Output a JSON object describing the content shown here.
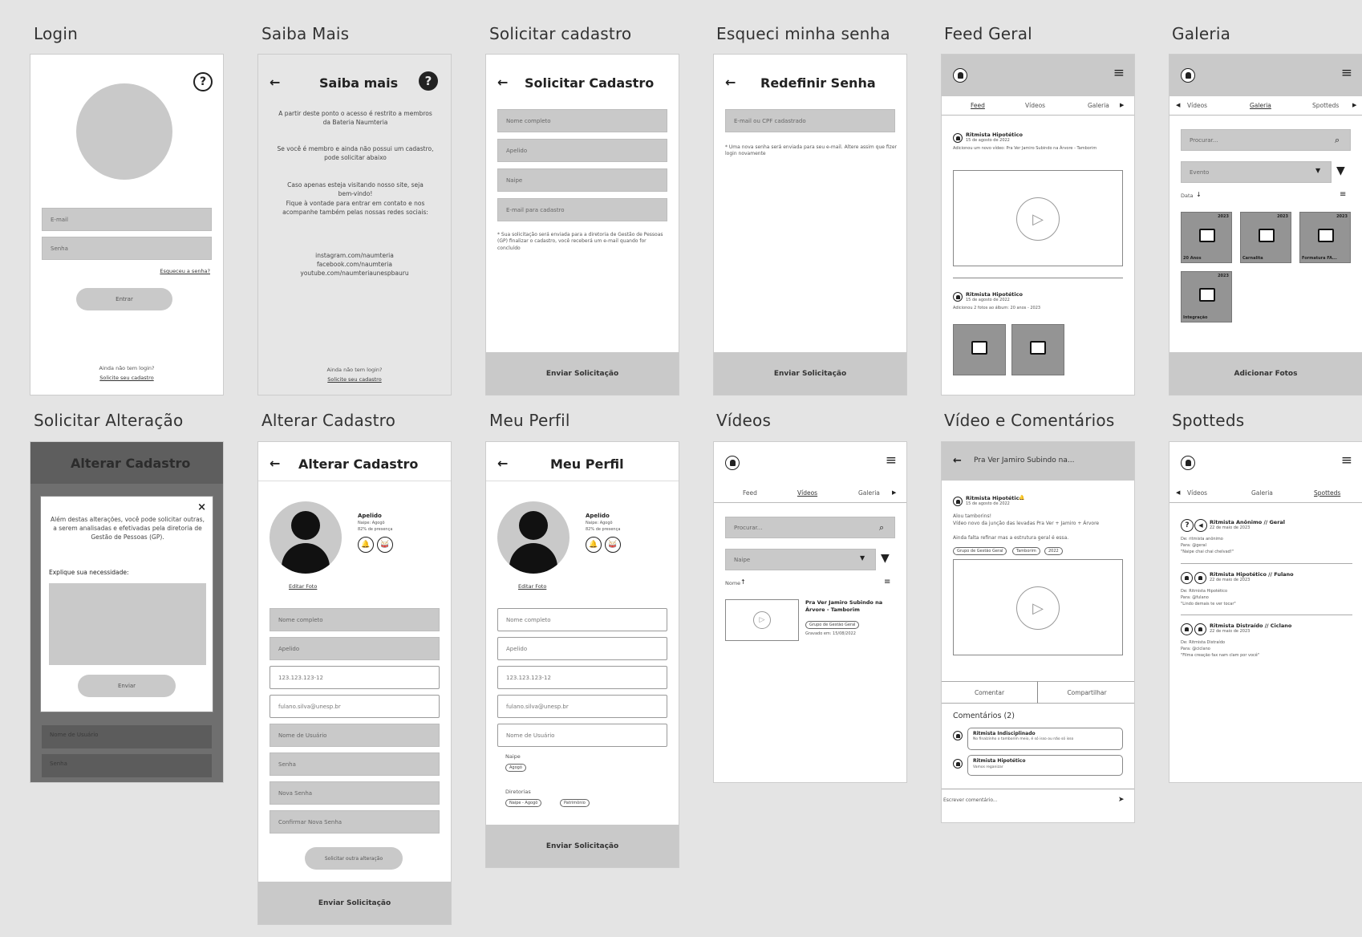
{
  "labels": [
    "Login",
    "Saiba Mais",
    "Solicitar cadastro",
    "Esqueci minha senha",
    "Feed Geral",
    "Galeria",
    "Solicitar Alteração",
    "Alterar Cadastro",
    "Meu Perfil",
    "Vídeos",
    "Vídeo e Comentários",
    "Spotteds"
  ],
  "login": {
    "help": "?",
    "email": "E-mail",
    "senha": "Senha",
    "forgot": "Esqueceu a senha?",
    "enter": "Entrar",
    "no_login": "Ainda não tem login?",
    "request": "Solicite seu cadastro"
  },
  "saiba": {
    "back": "←",
    "title": "Saiba mais",
    "help": "?",
    "p1": "A partir deste ponto o acesso é restrito a membros da Bateria Naumteria",
    "p2": "Se você é membro e ainda não possui um cadastro, pode solicitar abaixo",
    "p3": "Caso apenas esteja visitando nosso site, seja bem-vindo!",
    "p4": "Fique à vontade para entrar em contato e nos acompanhe também pelas nossas redes sociais:",
    "s1": "instagram.com/naumteria",
    "s2": "facebook.com/naumteria",
    "s3": "youtube.com/naumteriaunespbauru",
    "no_login": "Ainda não tem login?",
    "request": "Solicite seu cadastro"
  },
  "solicitar": {
    "back": "←",
    "title": "Solicitar Cadastro",
    "f1": "Nome completo",
    "f2": "Apelido",
    "f3": "Naipe",
    "f4": "E-mail para cadastro",
    "note": "* Sua solicitação será enviada para a diretoria de Gestão de Pessoas (GP) finalizar o cadastro, você receberá um e-mail quando for concluído",
    "submit": "Enviar Solicitação"
  },
  "esqueci": {
    "back": "←",
    "title": "Redefinir Senha",
    "f1": "E-mail ou CPF cadastrado",
    "note": "* Uma nova senha será enviada para seu e-mail. Altere assim que fizer login novamente",
    "submit": "Enviar Solicitação"
  },
  "feed": {
    "menu": "≡",
    "tab1": "Feed",
    "tab2": "Vídeos",
    "tab3": "Galeria",
    "arrow": "▶",
    "p1_name": "Ritmista Hipotético",
    "p1_date": "15 de agosto de 2022",
    "p1_text": "Adicionou um novo vídeo: Pra Ver Jamiro Subindo na Árvore - Tamborim",
    "p2_name": "Ritmista Hipotético",
    "p2_date": "15 de agosto de 2022",
    "p2_text": "Adicionou 2 fotos ao álbum: 20 anos - 2023"
  },
  "galeria": {
    "menu": "≡",
    "tab1": "Vídeos",
    "tab2": "Galeria",
    "tab3": "Spotteds",
    "arrow_l": "◀",
    "arrow_r": "▶",
    "search": "Procurar...",
    "event": "Evento",
    "sort": "Data",
    "items": [
      {
        "year": "2023",
        "cap": "20 Anos"
      },
      {
        "year": "2023",
        "cap": "Carnalita"
      },
      {
        "year": "2023",
        "cap": "Formatura FA..."
      },
      {
        "year": "2023",
        "cap": "Integração"
      }
    ],
    "submit": "Adicionar Fotos"
  },
  "salt": {
    "title": "Alterar Cadastro",
    "close": "×",
    "text": "Além destas alterações, você pode solicitar outras, a serem analisadas e efetivadas pela diretoria de Gestão de Pessoas (GP).",
    "explain": "Explique sua necessidade:",
    "send": "Enviar",
    "bg1": "Nome de Usuário",
    "bg2": "Senha"
  },
  "alterar": {
    "back": "←",
    "title": "Alterar Cadastro",
    "nick": "Apelido",
    "naipe": "Naipe: Agogô",
    "pres": "82% de presença",
    "edit": "Editar Foto",
    "f": [
      "Nome completo",
      "Apelido",
      "123.123.123-12",
      "fulano.silva@unesp.br",
      "Nome de Usuário",
      "Senha",
      "Nova Senha",
      "Confirmar Nova Senha"
    ],
    "other": "Solicitar outra alteração",
    "submit": "Enviar Solicitação"
  },
  "perfil": {
    "back": "←",
    "title": "Meu Perfil",
    "nick": "Apelido",
    "naipe": "Naipe: Agogô",
    "pres": "82% de presença",
    "edit": "Editar Foto",
    "f": [
      "Nome completo",
      "Apelido",
      "123.123.123-12",
      "fulano.silva@unesp.br",
      "Nome de Usuário"
    ],
    "naipe_lbl": "Naipe",
    "naipe_tag": "Agogô",
    "dir_lbl": "Diretorias",
    "dir1": "Naipe - Agogô",
    "dir2": "Patrimônio",
    "submit": "Enviar Solicitação"
  },
  "videos": {
    "menu": "≡",
    "tab1": "Feed",
    "tab2": "Vídeos",
    "tab3": "Galeria",
    "arrow": "▶",
    "search": "Procurar...",
    "naipe": "Naipe",
    "sort": "Nome",
    "v_title": "Pra Ver Jamiro Subindo na Árvore - Tamborim",
    "v_tag": "Grupo de Gestão Geral",
    "v_date": "Gravado em: 15/08/2022"
  },
  "vcom": {
    "back": "←",
    "title": "Pra Ver Jamiro Subindo na...",
    "name": "Ritmista Hipotético",
    "date": "15 de agosto de 2022",
    "text1": "Alou tamborins!",
    "text2": "Vídeo novo da junção das levadas Pra Ver + Jamiro + Árvore",
    "text3": "Ainda falta refinar mas a estrutura geral é essa.",
    "tag1": "Grupo de Gestão Geral",
    "tag2": "Tamborim",
    "tag3": "2022",
    "comment": "Comentar",
    "share": "Compartilhar",
    "ctitle": "Comentários (2)",
    "c1_name": "Ritmista Indisciplinado",
    "c1_text": "No finalzinho o tamborim meio, é só isso ou não só isso",
    "c2_name": "Ritmista Hipotético",
    "c2_text": "Vamos reganizar",
    "write": "Escrever comentário...",
    "send": "➤"
  },
  "spot": {
    "menu": "≡",
    "tab1": "Vídeos",
    "tab2": "Galeria",
    "tab3": "Spotteds",
    "arrow_l": "◀",
    "s1_title": "Ritmista Anônimo // Geral",
    "s1_date": "22 de maio de 2023",
    "s1_de": "De: ritmista anônimo",
    "s1_para": "Para: @geral",
    "s1_msg": "\"Naipe chai chai chelvad!\"",
    "s2_title": "Ritmista Hipotético // Fulano",
    "s2_date": "22 de maio de 2023",
    "s2_de": "De: Ritmista Hipotético",
    "s2_para": "Para: @fulano",
    "s2_msg": "\"Lindo demais te ver tocar\"",
    "s3_title": "Ritmista Distraído // Ciclano",
    "s3_date": "22 de maio de 2023",
    "s3_de": "De: Ritmista Distraído",
    "s3_para": "Para: @ciclano",
    "s3_msg": "\"Filma creação fax nam clam por você\""
  }
}
